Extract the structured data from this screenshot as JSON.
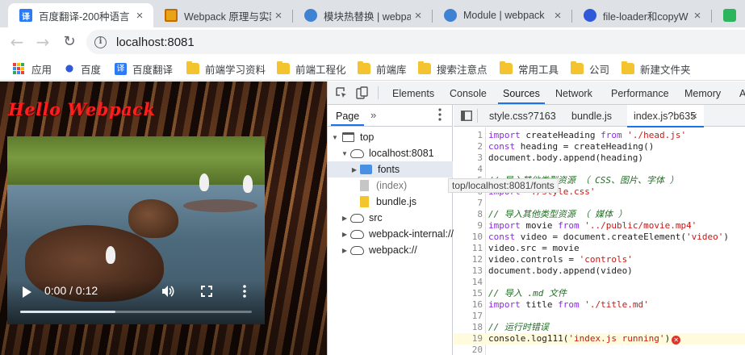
{
  "browser": {
    "tabs": [
      {
        "title": "百度翻译-200种语言",
        "favicon_color": "#2b7bf6",
        "favicon_char": "译"
      },
      {
        "title": "Webpack 原理与实践",
        "favicon_color": "#e8a317",
        "favicon_char": ""
      },
      {
        "title": "模块热替换 | webpack",
        "favicon_color": "#3f82d4",
        "favicon_char": ""
      },
      {
        "title": "Module | webpack",
        "favicon_color": "#3f82d4",
        "favicon_char": ""
      },
      {
        "title": "file-loader和copyW",
        "favicon_color": "#2e59d9",
        "favicon_char": ""
      }
    ],
    "url": "localhost:8081",
    "bookmarks": [
      {
        "label": "应用",
        "icon": "apps-icon"
      },
      {
        "label": "百度",
        "icon": "baidu-paw-icon"
      },
      {
        "label": "百度翻译",
        "icon": "translate-icon"
      },
      {
        "label": "前端学习资料",
        "icon": "folder-icon"
      },
      {
        "label": "前端工程化",
        "icon": "folder-icon"
      },
      {
        "label": "前端库",
        "icon": "folder-icon"
      },
      {
        "label": "搜索注意点",
        "icon": "folder-icon"
      },
      {
        "label": "常用工具",
        "icon": "folder-icon"
      },
      {
        "label": "公司",
        "icon": "folder-icon"
      },
      {
        "label": "新建文件夹",
        "icon": "folder-icon"
      }
    ]
  },
  "page": {
    "heading": "Hello Webpack",
    "video": {
      "time": "0:00 / 0:12",
      "buffered_fraction": 0.41
    }
  },
  "devtools": {
    "tabs": [
      "Elements",
      "Console",
      "Sources",
      "Network",
      "Performance",
      "Memory",
      "A"
    ],
    "active_tab": "Sources",
    "navigator": {
      "tab": "Page",
      "tree": [
        {
          "label": "top",
          "icon": "frame-icon"
        },
        {
          "label": "localhost:8081",
          "icon": "cloud-icon"
        },
        {
          "label": "fonts",
          "icon": "folder-icon"
        },
        {
          "label": "(index)",
          "icon": "file-icon"
        },
        {
          "label": "bundle.js",
          "icon": "js-file-icon"
        },
        {
          "label": "src",
          "icon": "cloud-icon"
        },
        {
          "label": "webpack-internal://",
          "icon": "cloud-icon"
        },
        {
          "label": "webpack://",
          "icon": "cloud-icon"
        }
      ],
      "tooltip": "top/localhost:8081/fonts"
    },
    "editor_tabs": [
      "style.css?7163",
      "bundle.js",
      "index.js?b635"
    ],
    "code_lines": [
      "import createHeading from './head.js'",
      "const heading = createHeading()",
      "document.body.append(heading)",
      "",
      "// 导入其他类型资源 （ CSS、图片、字体 ）",
      "import './style.css'",
      "",
      "// 导入其他类型资源 （ 媒体 ）",
      "import movie from '../public/movie.mp4'",
      "const video = document.createElement('video')",
      "video.src = movie",
      "video.controls = 'controls'",
      "document.body.append(video)",
      "",
      "// 导入 .md 文件",
      "import title from './title.md'",
      "",
      "// 运行时错误",
      "console.log111('index.js running')",
      ""
    ],
    "error_line": 19
  },
  "colors": {
    "accent": "#1a73e8",
    "error": "#e0352b",
    "heading": "#ff1e1e"
  }
}
